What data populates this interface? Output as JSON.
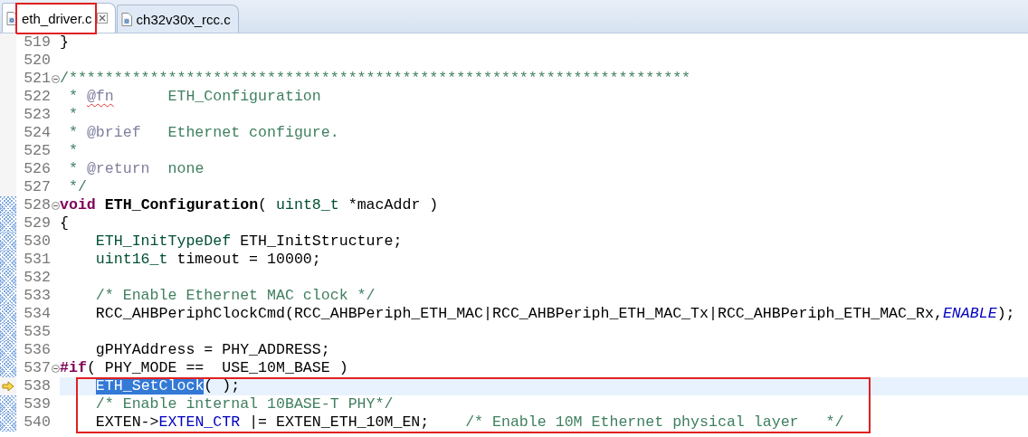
{
  "tabs": [
    {
      "label": "eth_driver.c",
      "selected": true,
      "closable": true,
      "outlined": true
    },
    {
      "label": "ch32v30x_rcc.c",
      "selected": false,
      "closable": false,
      "outlined": false
    }
  ],
  "editor": {
    "lines": [
      {
        "number": "519",
        "foldable": false,
        "changed": false,
        "current": false,
        "outlined": false,
        "tokens": [
          {
            "kind": "plain",
            "text": "}"
          }
        ]
      },
      {
        "number": "520",
        "foldable": false,
        "changed": false,
        "current": false,
        "outlined": false
      },
      {
        "number": "521",
        "foldable": true,
        "changed": false,
        "current": false,
        "outlined": false,
        "tokens": [
          {
            "kind": "comment",
            "text": "/*********************************************************************"
          }
        ]
      },
      {
        "number": "522",
        "foldable": false,
        "changed": false,
        "current": false,
        "outlined": false,
        "tokens": [
          {
            "kind": "comment",
            "text": " * "
          },
          {
            "kind": "doc-tag-misspelled",
            "text": "@fn"
          },
          {
            "kind": "comment",
            "text": "      ETH_Configuration"
          }
        ]
      },
      {
        "number": "523",
        "foldable": false,
        "changed": false,
        "current": false,
        "outlined": false,
        "tokens": [
          {
            "kind": "comment",
            "text": " *"
          }
        ]
      },
      {
        "number": "524",
        "foldable": false,
        "changed": false,
        "current": false,
        "outlined": false,
        "tokens": [
          {
            "kind": "comment",
            "text": " * "
          },
          {
            "kind": "doc-tag",
            "text": "@brief"
          },
          {
            "kind": "comment",
            "text": "   Ethernet configure."
          }
        ]
      },
      {
        "number": "525",
        "foldable": false,
        "changed": false,
        "current": false,
        "outlined": false,
        "tokens": [
          {
            "kind": "comment",
            "text": " *"
          }
        ]
      },
      {
        "number": "526",
        "foldable": false,
        "changed": false,
        "current": false,
        "outlined": false,
        "tokens": [
          {
            "kind": "comment",
            "text": " * "
          },
          {
            "kind": "doc-tag",
            "text": "@return"
          },
          {
            "kind": "comment",
            "text": "  none"
          }
        ]
      },
      {
        "number": "527",
        "foldable": false,
        "changed": false,
        "current": false,
        "outlined": false,
        "tokens": [
          {
            "kind": "comment",
            "text": " */"
          }
        ]
      },
      {
        "number": "528",
        "foldable": true,
        "changed": true,
        "current": false,
        "outlined": false,
        "tokens": [
          {
            "kind": "keyword",
            "text": "void"
          },
          {
            "kind": "function",
            "text": " ETH_Configuration"
          },
          {
            "kind": "plain",
            "text": "( "
          },
          {
            "kind": "type",
            "text": "uint8_t"
          },
          {
            "kind": "plain",
            "text": " *macAddr )"
          }
        ]
      },
      {
        "number": "529",
        "foldable": false,
        "changed": true,
        "current": false,
        "outlined": false,
        "tokens": [
          {
            "kind": "plain",
            "text": "{"
          }
        ]
      },
      {
        "number": "530",
        "foldable": false,
        "changed": true,
        "current": false,
        "outlined": false,
        "tokens": [
          {
            "kind": "type",
            "text": "    ETH_InitTypeDef"
          },
          {
            "kind": "plain",
            "text": " ETH_InitStructure;"
          }
        ]
      },
      {
        "number": "531",
        "foldable": false,
        "changed": true,
        "current": false,
        "outlined": false,
        "tokens": [
          {
            "kind": "type",
            "text": "    uint16_t"
          },
          {
            "kind": "plain",
            "text": " timeout = 10000;"
          }
        ]
      },
      {
        "number": "532",
        "foldable": false,
        "changed": true,
        "current": false,
        "outlined": false
      },
      {
        "number": "533",
        "foldable": false,
        "changed": true,
        "current": false,
        "outlined": false,
        "tokens": [
          {
            "kind": "comment",
            "text": "    /* Enable Ethernet MAC clock */"
          }
        ]
      },
      {
        "number": "534",
        "foldable": false,
        "changed": true,
        "current": false,
        "outlined": false,
        "tokens": [
          {
            "kind": "plain",
            "text": "    RCC_AHBPeriphClockCmd(RCC_AHBPeriph_ETH_MAC|RCC_AHBPeriph_ETH_MAC_Tx|RCC_AHBPeriph_ETH_MAC_Rx,"
          },
          {
            "kind": "enum",
            "text": "ENABLE"
          },
          {
            "kind": "plain",
            "text": ");"
          }
        ]
      },
      {
        "number": "535",
        "foldable": false,
        "changed": true,
        "current": false,
        "outlined": false
      },
      {
        "number": "536",
        "foldable": false,
        "changed": true,
        "current": false,
        "outlined": false,
        "tokens": [
          {
            "kind": "plain",
            "text": "    gPHYAddress = PHY_ADDRESS;"
          }
        ]
      },
      {
        "number": "537",
        "foldable": true,
        "changed": true,
        "current": false,
        "outlined": false,
        "tokens": [
          {
            "kind": "keyword",
            "text": "#if"
          },
          {
            "kind": "plain",
            "text": "( PHY_MODE ==  USE_10M_BASE )"
          }
        ]
      },
      {
        "number": "538",
        "foldable": false,
        "changed": false,
        "current": true,
        "outlined": true,
        "tokens": [
          {
            "kind": "selected",
            "text": "    ETH_SetClock"
          },
          {
            "kind": "plain",
            "text": "( );"
          }
        ]
      },
      {
        "number": "539",
        "foldable": false,
        "changed": true,
        "current": false,
        "outlined": true,
        "tokens": [
          {
            "kind": "comment",
            "text": "    /* Enable internal 10BASE-T PHY*/"
          }
        ]
      },
      {
        "number": "540",
        "foldable": false,
        "changed": true,
        "current": false,
        "outlined": true,
        "tokens": [
          {
            "kind": "plain",
            "text": "    EXTEN->"
          },
          {
            "kind": "field",
            "text": "EXTEN_CTR"
          },
          {
            "kind": "plain",
            "text": " |= EXTEN_ETH_10M_EN;    "
          },
          {
            "kind": "comment",
            "text": "/* Enable 10M Ethernet physical layer   */"
          }
        ]
      }
    ]
  }
}
